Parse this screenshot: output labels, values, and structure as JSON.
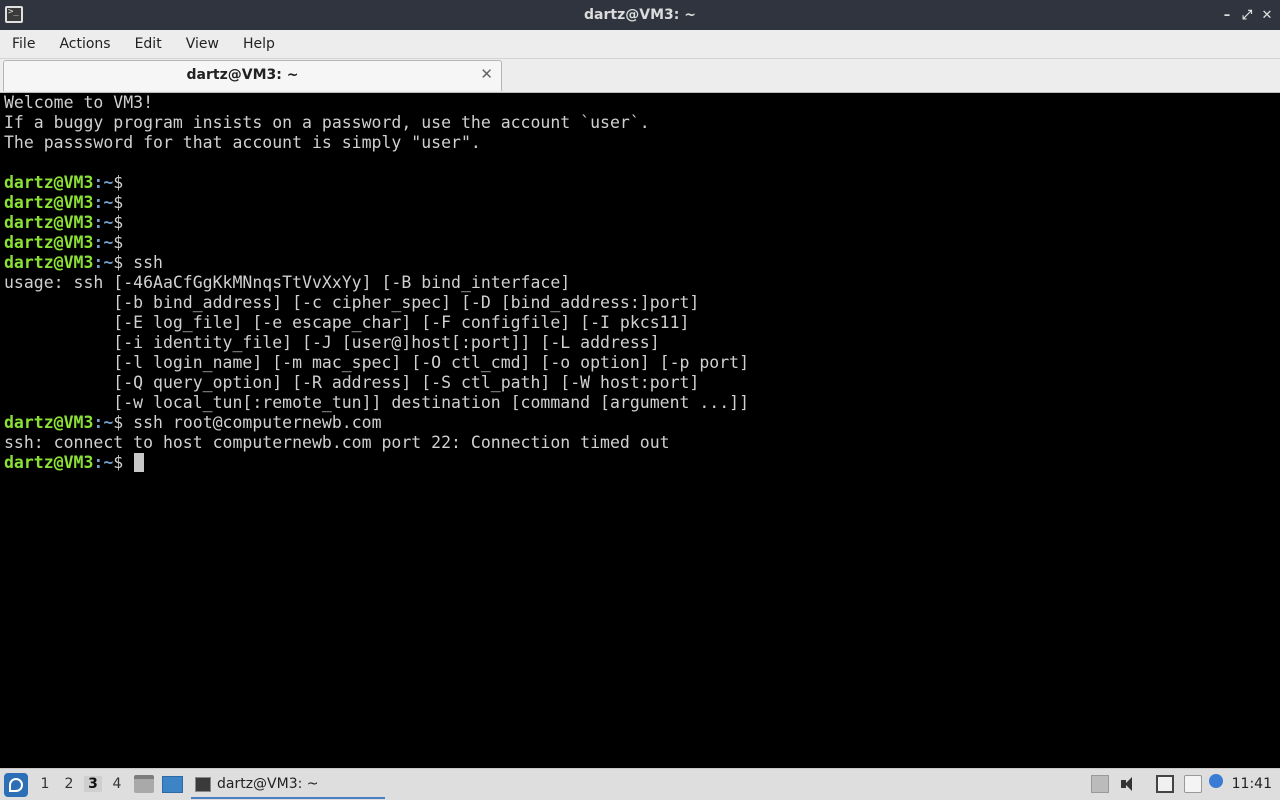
{
  "window": {
    "title": "dartz@VM3: ~"
  },
  "menu": {
    "items": [
      "File",
      "Actions",
      "Edit",
      "View",
      "Help"
    ]
  },
  "tab": {
    "label": "dartz@VM3: ~",
    "close": "✕"
  },
  "prompt": {
    "user_host": "dartz@VM3",
    "path": ":~",
    "symbol": "$"
  },
  "terminal": {
    "lines": [
      {
        "type": "text",
        "text": "Welcome to VM3!"
      },
      {
        "type": "text",
        "text": "If a buggy program insists on a password, use the account `user`."
      },
      {
        "type": "text",
        "text": "The passsword for that account is simply \"user\"."
      },
      {
        "type": "text",
        "text": ""
      },
      {
        "type": "prompt",
        "cmd": ""
      },
      {
        "type": "prompt",
        "cmd": ""
      },
      {
        "type": "prompt",
        "cmd": ""
      },
      {
        "type": "prompt",
        "cmd": ""
      },
      {
        "type": "prompt",
        "cmd": " ssh"
      },
      {
        "type": "text",
        "text": "usage: ssh [-46AaCfGgKkMNnqsTtVvXxYy] [-B bind_interface]"
      },
      {
        "type": "text",
        "text": "           [-b bind_address] [-c cipher_spec] [-D [bind_address:]port]"
      },
      {
        "type": "text",
        "text": "           [-E log_file] [-e escape_char] [-F configfile] [-I pkcs11]"
      },
      {
        "type": "text",
        "text": "           [-i identity_file] [-J [user@]host[:port]] [-L address]"
      },
      {
        "type": "text",
        "text": "           [-l login_name] [-m mac_spec] [-O ctl_cmd] [-o option] [-p port]"
      },
      {
        "type": "text",
        "text": "           [-Q query_option] [-R address] [-S ctl_path] [-W host:port]"
      },
      {
        "type": "text",
        "text": "           [-w local_tun[:remote_tun]] destination [command [argument ...]]"
      },
      {
        "type": "prompt",
        "cmd": " ssh root@computernewb.com"
      },
      {
        "type": "text",
        "text": "ssh: connect to host computernewb.com port 22: Connection timed out"
      },
      {
        "type": "prompt",
        "cmd": " ",
        "cursor": true
      }
    ]
  },
  "taskbar": {
    "desktops": [
      "1",
      "2",
      "3",
      "4"
    ],
    "active_desktop": "3",
    "task_label": "dartz@VM3: ~",
    "clock": "11:41"
  },
  "icons": {
    "app": "terminal-icon",
    "start": "lxqt-start-icon",
    "file_manager": "file-manager-icon",
    "show_desktop": "show-desktop-icon",
    "volume": "volume-icon",
    "network": "network-icon",
    "clipboard": "clipboard-icon",
    "info": "info-icon"
  },
  "colors": {
    "prompt_user": "#8ae234",
    "prompt_path": "#729fcf",
    "terminal_bg": "#000000",
    "terminal_fg": "#d0d0d0",
    "titlebar_bg": "#2f343f"
  }
}
